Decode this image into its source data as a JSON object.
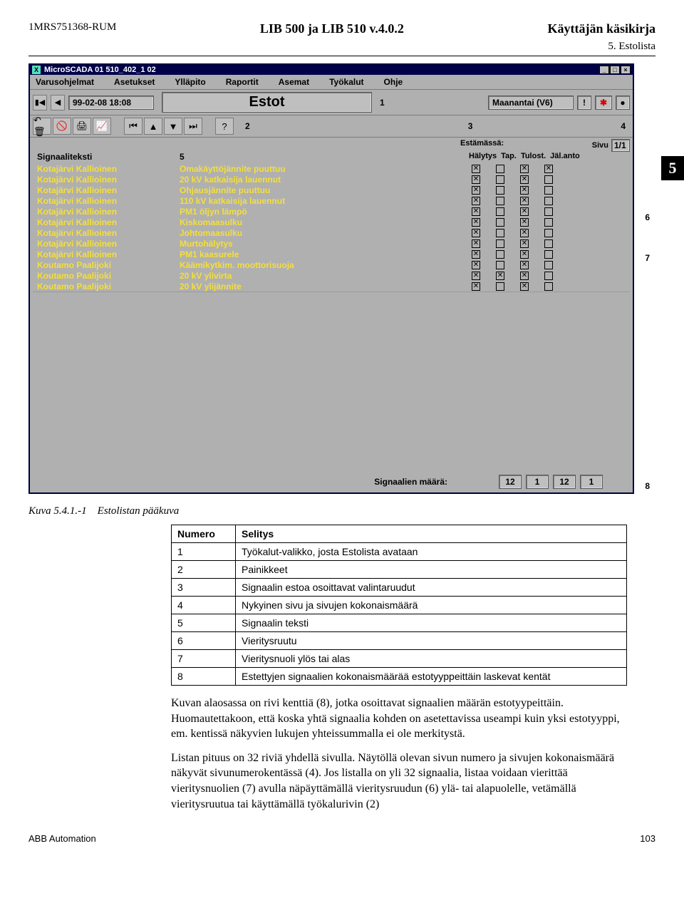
{
  "header": {
    "doc_id": "1MRS751368-RUM",
    "product": "LIB 500 ja LIB 510 v.4.0.2",
    "doctype": "Käyttäjän käsikirja",
    "section": "5. Estolista"
  },
  "window": {
    "title": "MicroSCADA 01 510_402_1 02",
    "menu": [
      "Varusohjelmat",
      "Asetukset",
      "Ylläpito",
      "Raportit",
      "Asemat",
      "Työkalut",
      "Ohje"
    ],
    "time": "99-02-08  18:08",
    "main_title": "Estot",
    "day": "Maanantai  (V6)",
    "sig_header": "Signaaliteksti",
    "est_header_top": "Estämässä:",
    "est_headers": [
      "Hälytys",
      "Tap.",
      "Tulost.",
      "Jäl.anto"
    ],
    "sivu_label": "Sivu",
    "page": "1/1",
    "rows": [
      {
        "a": "Kotajärvi Kallioinen",
        "b": "Omakäyttöjännite puuttuu",
        "c": [
          1,
          0,
          1,
          1
        ]
      },
      {
        "a": "Kotajärvi Kallioinen",
        "b": "20 kV katkaisija lauennut",
        "c": [
          1,
          0,
          1,
          0
        ]
      },
      {
        "a": "Kotajärvi Kallioinen",
        "b": "Ohjausjännite puuttuu",
        "c": [
          1,
          0,
          1,
          0
        ]
      },
      {
        "a": "Kotajärvi Kallioinen",
        "b": "110 kV katkaisija lauennut",
        "c": [
          1,
          0,
          1,
          0
        ]
      },
      {
        "a": "Kotajärvi Kallioinen",
        "b": "PM1 öljyn lämpö",
        "c": [
          1,
          0,
          1,
          0
        ]
      },
      {
        "a": "Kotajärvi Kallioinen",
        "b": "Kiskomaasulku",
        "c": [
          1,
          0,
          1,
          0
        ]
      },
      {
        "a": "Kotajärvi Kallioinen",
        "b": "Johtomaasulku",
        "c": [
          1,
          0,
          1,
          0
        ]
      },
      {
        "a": "Kotajärvi Kallioinen",
        "b": "Murtohälytys",
        "c": [
          1,
          0,
          1,
          0
        ]
      },
      {
        "a": "Kotajärvi Kallioinen",
        "b": "PM1 kaasurele",
        "c": [
          1,
          0,
          1,
          0
        ]
      },
      {
        "a": "Koutamo  Paalijoki",
        "b": "Käämikytkim. moottorisuoja",
        "c": [
          1,
          0,
          1,
          0
        ]
      },
      {
        "a": "Koutamo  Paalijoki",
        "b": "20 kV ylivirta",
        "c": [
          1,
          1,
          1,
          0
        ]
      },
      {
        "a": "Koutamo  Paalijoki",
        "b": "20 kV ylijännite",
        "c": [
          1,
          0,
          1,
          0
        ]
      }
    ],
    "status_label": "Signaalien määrä:",
    "status_counts": [
      "12",
      "1",
      "12",
      "1"
    ]
  },
  "callouts": {
    "c1": "1",
    "c2": "2",
    "c3": "3",
    "c4": "4",
    "c5": "5",
    "c6": "6",
    "c7": "7",
    "c8": "8"
  },
  "caption": {
    "id": "Kuva 5.4.1.-1",
    "text": "Estolistan pääkuva"
  },
  "table": {
    "head": [
      "Numero",
      "Selitys"
    ],
    "rows": [
      [
        "1",
        "Työkalut-valikko, josta Estolista avataan"
      ],
      [
        "2",
        "Painikkeet"
      ],
      [
        "3",
        "Signaalin estoa osoittavat valintaruudut"
      ],
      [
        "4",
        "Nykyinen sivu ja sivujen kokonaismäärä"
      ],
      [
        "5",
        "Signaalin teksti"
      ],
      [
        "6",
        "Vieritysruutu"
      ],
      [
        "7",
        "Vieritysnuoli ylös tai alas"
      ],
      [
        "8",
        "Estettyjen signaalien kokonaismäärää estotyyppeittäin laskevat kentät"
      ]
    ]
  },
  "paragraphs": [
    "Kuvan alaosassa on rivi kenttiä (8), jotka osoittavat signaalien määrän estotyypeittäin. Huomautettakoon, että koska yhtä signaalia kohden on asetettavissa useampi kuin yksi estotyyppi, em. kentissä näkyvien lukujen yhteissummalla ei ole merkitystä.",
    "Listan pituus on 32 riviä yhdellä sivulla. Näytöllä olevan sivun numero ja sivujen kokonaismäärä näkyvät sivunumerokentässä (4). Jos listalla on yli 32 signaalia, listaa voidaan vierittää vieritysnuolien (7) avulla näpäyttämällä vieritysruudun (6) ylä- tai alapuolelle, vetämällä vieritysruutua tai käyttämällä työkalurivin (2)"
  ],
  "footer": {
    "left": "ABB Automation",
    "page": "103"
  },
  "tab": "5"
}
